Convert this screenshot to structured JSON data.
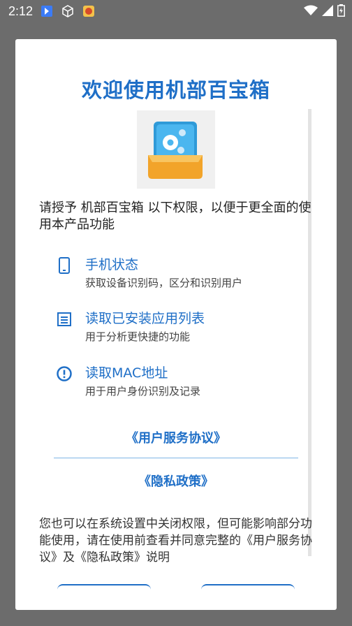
{
  "status_bar": {
    "time": "2:12"
  },
  "dialog": {
    "title": "欢迎使用机部百宝箱",
    "intro": "请授予 机部百宝箱 以下权限，以便于更全面的使用本产品功能",
    "permissions": [
      {
        "title": "手机状态",
        "desc": "获取设备识别码，区分和识别用户",
        "icon": "phone-icon"
      },
      {
        "title": "读取已安装应用列表",
        "desc": "用于分析更快捷的功能",
        "icon": "list-icon"
      },
      {
        "title": "读取MAC地址",
        "desc": "用于用户身份识别及记录",
        "icon": "info-icon"
      }
    ],
    "links": {
      "user_agreement": "《用户服务协议》",
      "privacy_policy": "《隐私政策》"
    },
    "footer": "您也可以在系统设置中关闭权限，但可能影响部分功能使用，请在使用前查看并同意完整的《用户服务协议》及《隐私政策》说明",
    "buttons": {
      "left": "",
      "right": ""
    }
  },
  "colors": {
    "accent": "#1f6fc7",
    "scrim": "#6c6c6c"
  }
}
